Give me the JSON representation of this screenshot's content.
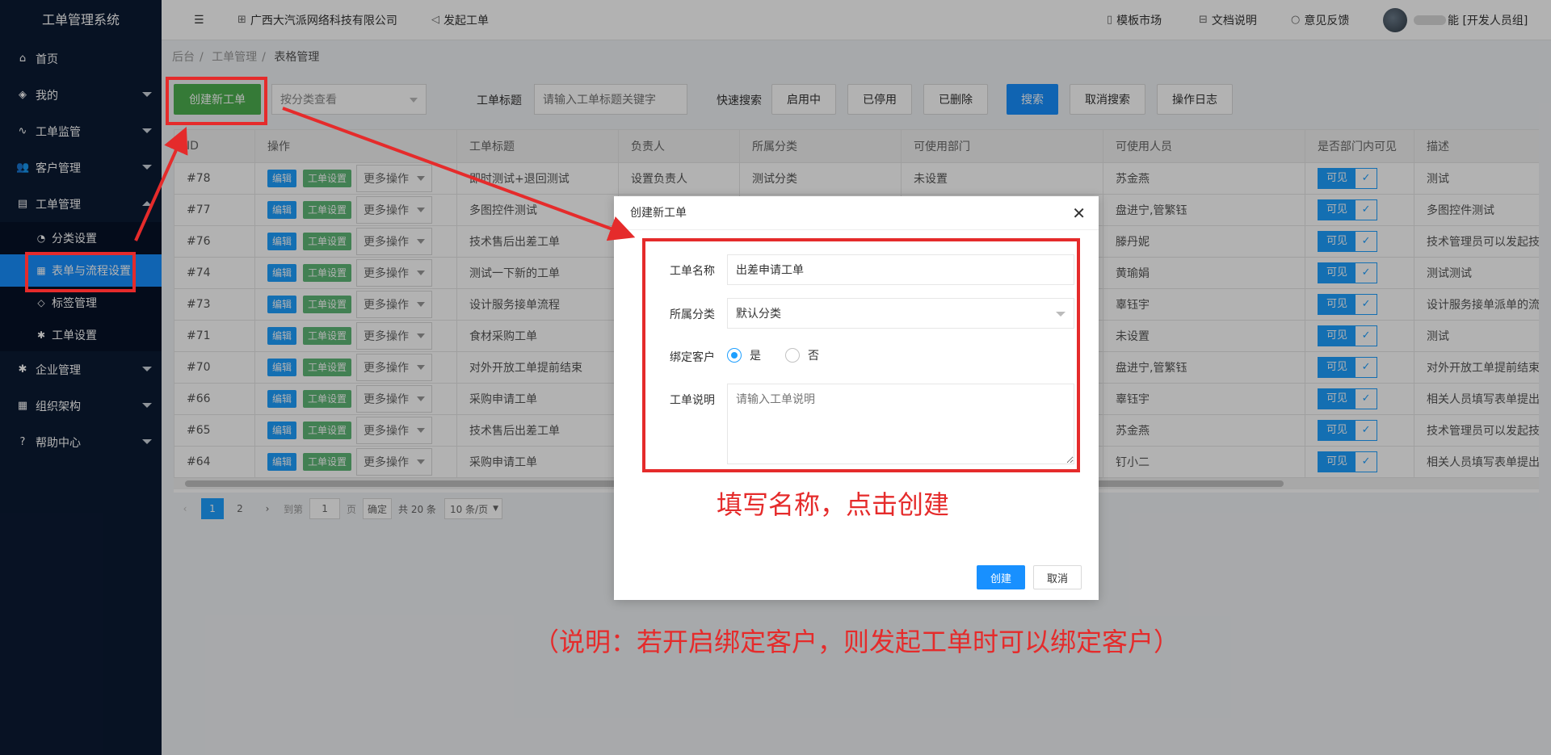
{
  "sidebar": {
    "title": "工单管理系统",
    "items": [
      {
        "label": "首页",
        "icon": "⌂"
      },
      {
        "label": "我的",
        "icon": "◈"
      },
      {
        "label": "工单监管",
        "icon": "∿"
      },
      {
        "label": "客户管理",
        "icon": "👥"
      },
      {
        "label": "工单管理",
        "icon": "▤"
      }
    ],
    "sub_items": [
      {
        "label": "分类设置",
        "icon": "◔"
      },
      {
        "label": "表单与流程设置",
        "icon": "▦"
      },
      {
        "label": "标签管理",
        "icon": "◇"
      },
      {
        "label": "工单设置",
        "icon": "✱"
      }
    ],
    "items_bottom": [
      {
        "label": "企业管理",
        "icon": "✱"
      },
      {
        "label": "组织架构",
        "icon": "▦"
      },
      {
        "label": "帮助中心",
        "icon": "?"
      }
    ]
  },
  "header": {
    "menu_icon": "☰",
    "company": "广西大汽派网络科技有限公司",
    "launch": "发起工单",
    "template_market": "模板市场",
    "docs": "文档说明",
    "feedback": "意见反馈",
    "user_role": "能 [开发人员组]"
  },
  "breadcrumb": [
    "后台",
    "工单管理",
    "表格管理"
  ],
  "toolbar": {
    "create_button": "创建新工单",
    "category_select": "按分类查看",
    "title_label": "工单标题",
    "title_placeholder": "请输入工单标题关键字",
    "quick_search_label": "快速搜索",
    "enabled": "启用中",
    "disabled": "已停用",
    "deleted": "已删除",
    "search": "搜索",
    "cancel_search": "取消搜索",
    "log": "操作日志"
  },
  "table": {
    "columns": [
      "ID",
      "操作",
      "工单标题",
      "负责人",
      "所属分类",
      "可使用部门",
      "可使用人员",
      "是否部门内可见",
      "描述"
    ],
    "edit_label": "编辑",
    "settings_label": "工单设置",
    "more_label": "更多操作",
    "visible_label": "可见",
    "rows": [
      {
        "id": "#78",
        "title": "即时测试+退回测试",
        "owner": "设置负责人",
        "category": "测试分类",
        "dept": "未设置",
        "users": "苏金燕",
        "desc": "测试"
      },
      {
        "id": "#77",
        "title": "多图控件测试",
        "owner": "",
        "category": "",
        "dept": "",
        "users": "盘进宁,管繁钰",
        "desc": "多图控件测试"
      },
      {
        "id": "#76",
        "title": "技术售后出差工单",
        "owner": "",
        "category": "",
        "dept": "",
        "users": "滕丹妮",
        "desc": "技术管理员可以发起技"
      },
      {
        "id": "#74",
        "title": "测试一下新的工单",
        "owner": "",
        "category": "",
        "dept": "",
        "users": "黄瑜娟",
        "desc": "测试测试"
      },
      {
        "id": "#73",
        "title": "设计服务接单流程",
        "owner": "",
        "category": "",
        "dept": "",
        "users": "辜钰宇",
        "desc": "设计服务接单派单的流"
      },
      {
        "id": "#71",
        "title": "食材采购工单",
        "owner": "",
        "category": "",
        "dept": "",
        "users": "未设置",
        "desc": "测试"
      },
      {
        "id": "#70",
        "title": "对外开放工单提前结束",
        "owner": "",
        "category": "",
        "dept": "",
        "users": "盘进宁,管繁钰",
        "desc": "对外开放工单提前结束"
      },
      {
        "id": "#66",
        "title": "采购申请工单",
        "owner": "",
        "category": "",
        "dept": "",
        "users": "辜钰宇",
        "desc": "相关人员填写表单提出"
      },
      {
        "id": "#65",
        "title": "技术售后出差工单",
        "owner": "",
        "category": "",
        "dept": "",
        "users": "苏金燕",
        "desc": "技术管理员可以发起技"
      },
      {
        "id": "#64",
        "title": "采购申请工单",
        "owner": "",
        "category": "",
        "dept": "",
        "users": "钉小二",
        "desc": "相关人员填写表单提出"
      }
    ]
  },
  "pager": {
    "page1": "1",
    "page2": "2",
    "goto_label": "到第",
    "goto_value": "1",
    "page_unit": "页",
    "confirm": "确定",
    "total": "共 20 条",
    "per_page": "10 条/页"
  },
  "modal": {
    "title": "创建新工单",
    "name_label": "工单名称",
    "name_value": "出差申请工单",
    "category_label": "所属分类",
    "category_value": "默认分类",
    "bind_label": "绑定客户",
    "yes": "是",
    "no": "否",
    "desc_label": "工单说明",
    "desc_placeholder": "请输入工单说明",
    "create": "创建",
    "cancel": "取消"
  },
  "annotations": {
    "fill_hint": "填写名称，点击创建",
    "note": "（说明：若开启绑定客户，则发起工单时可以绑定客户）"
  },
  "colors": {
    "sidebar_bg": "#0b1a33",
    "active_blue": "#1890ff",
    "green": "#4caf50",
    "annotation_red": "#e52b2b"
  }
}
